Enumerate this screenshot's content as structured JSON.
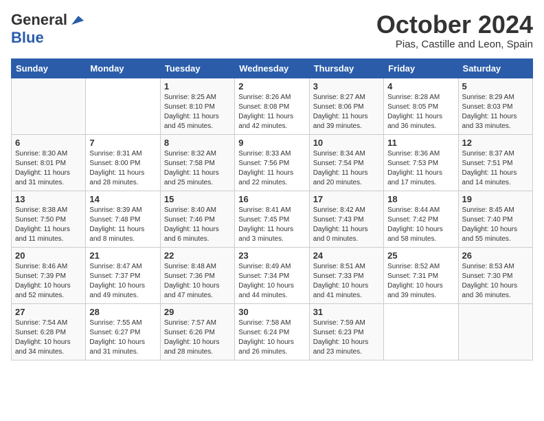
{
  "logo": {
    "general": "General",
    "blue": "Blue"
  },
  "title": "October 2024",
  "location": "Pias, Castille and Leon, Spain",
  "days_of_week": [
    "Sunday",
    "Monday",
    "Tuesday",
    "Wednesday",
    "Thursday",
    "Friday",
    "Saturday"
  ],
  "weeks": [
    [
      {
        "day": "",
        "content": ""
      },
      {
        "day": "",
        "content": ""
      },
      {
        "day": "1",
        "content": "Sunrise: 8:25 AM\nSunset: 8:10 PM\nDaylight: 11 hours and 45 minutes."
      },
      {
        "day": "2",
        "content": "Sunrise: 8:26 AM\nSunset: 8:08 PM\nDaylight: 11 hours and 42 minutes."
      },
      {
        "day": "3",
        "content": "Sunrise: 8:27 AM\nSunset: 8:06 PM\nDaylight: 11 hours and 39 minutes."
      },
      {
        "day": "4",
        "content": "Sunrise: 8:28 AM\nSunset: 8:05 PM\nDaylight: 11 hours and 36 minutes."
      },
      {
        "day": "5",
        "content": "Sunrise: 8:29 AM\nSunset: 8:03 PM\nDaylight: 11 hours and 33 minutes."
      }
    ],
    [
      {
        "day": "6",
        "content": "Sunrise: 8:30 AM\nSunset: 8:01 PM\nDaylight: 11 hours and 31 minutes."
      },
      {
        "day": "7",
        "content": "Sunrise: 8:31 AM\nSunset: 8:00 PM\nDaylight: 11 hours and 28 minutes."
      },
      {
        "day": "8",
        "content": "Sunrise: 8:32 AM\nSunset: 7:58 PM\nDaylight: 11 hours and 25 minutes."
      },
      {
        "day": "9",
        "content": "Sunrise: 8:33 AM\nSunset: 7:56 PM\nDaylight: 11 hours and 22 minutes."
      },
      {
        "day": "10",
        "content": "Sunrise: 8:34 AM\nSunset: 7:54 PM\nDaylight: 11 hours and 20 minutes."
      },
      {
        "day": "11",
        "content": "Sunrise: 8:36 AM\nSunset: 7:53 PM\nDaylight: 11 hours and 17 minutes."
      },
      {
        "day": "12",
        "content": "Sunrise: 8:37 AM\nSunset: 7:51 PM\nDaylight: 11 hours and 14 minutes."
      }
    ],
    [
      {
        "day": "13",
        "content": "Sunrise: 8:38 AM\nSunset: 7:50 PM\nDaylight: 11 hours and 11 minutes."
      },
      {
        "day": "14",
        "content": "Sunrise: 8:39 AM\nSunset: 7:48 PM\nDaylight: 11 hours and 8 minutes."
      },
      {
        "day": "15",
        "content": "Sunrise: 8:40 AM\nSunset: 7:46 PM\nDaylight: 11 hours and 6 minutes."
      },
      {
        "day": "16",
        "content": "Sunrise: 8:41 AM\nSunset: 7:45 PM\nDaylight: 11 hours and 3 minutes."
      },
      {
        "day": "17",
        "content": "Sunrise: 8:42 AM\nSunset: 7:43 PM\nDaylight: 11 hours and 0 minutes."
      },
      {
        "day": "18",
        "content": "Sunrise: 8:44 AM\nSunset: 7:42 PM\nDaylight: 10 hours and 58 minutes."
      },
      {
        "day": "19",
        "content": "Sunrise: 8:45 AM\nSunset: 7:40 PM\nDaylight: 10 hours and 55 minutes."
      }
    ],
    [
      {
        "day": "20",
        "content": "Sunrise: 8:46 AM\nSunset: 7:39 PM\nDaylight: 10 hours and 52 minutes."
      },
      {
        "day": "21",
        "content": "Sunrise: 8:47 AM\nSunset: 7:37 PM\nDaylight: 10 hours and 49 minutes."
      },
      {
        "day": "22",
        "content": "Sunrise: 8:48 AM\nSunset: 7:36 PM\nDaylight: 10 hours and 47 minutes."
      },
      {
        "day": "23",
        "content": "Sunrise: 8:49 AM\nSunset: 7:34 PM\nDaylight: 10 hours and 44 minutes."
      },
      {
        "day": "24",
        "content": "Sunrise: 8:51 AM\nSunset: 7:33 PM\nDaylight: 10 hours and 41 minutes."
      },
      {
        "day": "25",
        "content": "Sunrise: 8:52 AM\nSunset: 7:31 PM\nDaylight: 10 hours and 39 minutes."
      },
      {
        "day": "26",
        "content": "Sunrise: 8:53 AM\nSunset: 7:30 PM\nDaylight: 10 hours and 36 minutes."
      }
    ],
    [
      {
        "day": "27",
        "content": "Sunrise: 7:54 AM\nSunset: 6:28 PM\nDaylight: 10 hours and 34 minutes."
      },
      {
        "day": "28",
        "content": "Sunrise: 7:55 AM\nSunset: 6:27 PM\nDaylight: 10 hours and 31 minutes."
      },
      {
        "day": "29",
        "content": "Sunrise: 7:57 AM\nSunset: 6:26 PM\nDaylight: 10 hours and 28 minutes."
      },
      {
        "day": "30",
        "content": "Sunrise: 7:58 AM\nSunset: 6:24 PM\nDaylight: 10 hours and 26 minutes."
      },
      {
        "day": "31",
        "content": "Sunrise: 7:59 AM\nSunset: 6:23 PM\nDaylight: 10 hours and 23 minutes."
      },
      {
        "day": "",
        "content": ""
      },
      {
        "day": "",
        "content": ""
      }
    ]
  ]
}
